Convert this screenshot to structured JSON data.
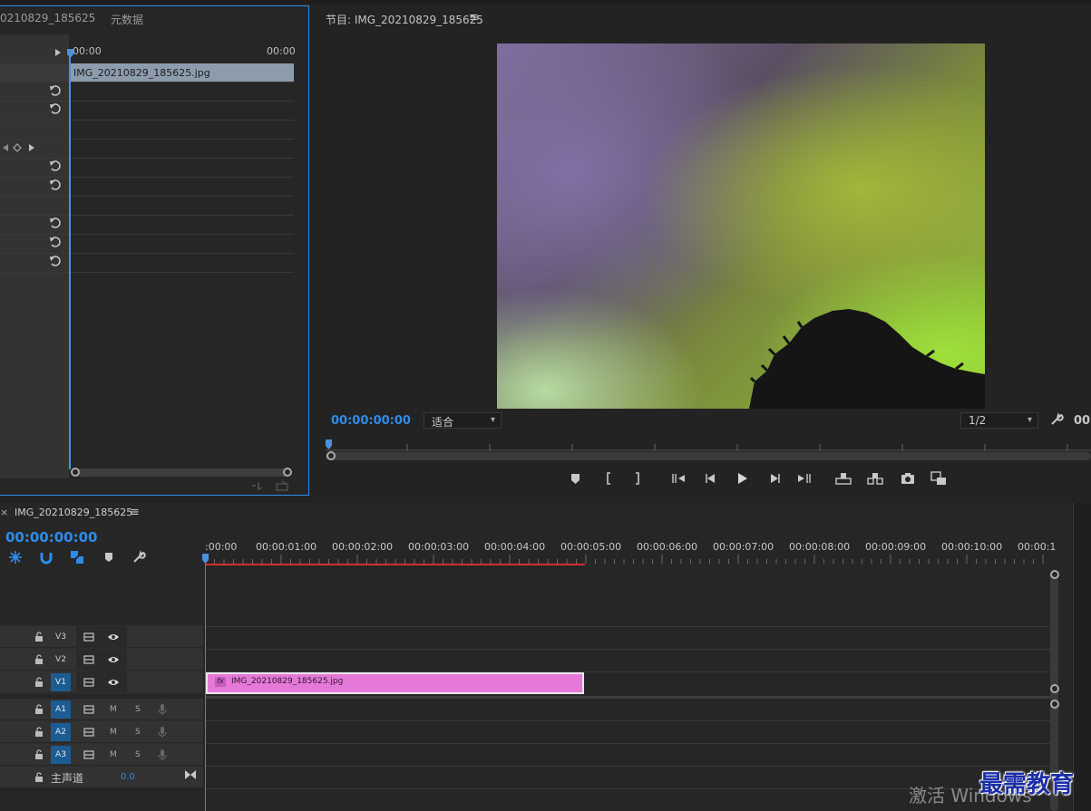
{
  "effect_controls": {
    "tab_source": "0210829_185625",
    "tab_metadata": "元数据",
    "start_tc": "00:00",
    "end_tc": "00:00",
    "clip_name": "IMG_20210829_185625.jpg"
  },
  "program_monitor": {
    "title": "节目: IMG_20210829_185625",
    "menu_icon": "≡",
    "timecode": "00:00:00:00",
    "fit_label": "适合",
    "resolution_label": "1/2",
    "end_timecode_partial": "00:"
  },
  "timeline": {
    "close_icon": "×",
    "sequence_name": "IMG_20210829_185625",
    "menu_icon": "≡",
    "timecode": "00:00:00:00",
    "ruler_labels": [
      ":00:00",
      "00:00:01:00",
      "00:00:02:00",
      "00:00:03:00",
      "00:00:04:00",
      "00:00:05:00",
      "00:00:06:00",
      "00:00:07:00",
      "00:00:08:00",
      "00:00:09:00",
      "00:00:10:00",
      "00:00:1"
    ],
    "video_tracks": [
      "V3",
      "V2",
      "V1"
    ],
    "audio_tracks": [
      "A1",
      "A2",
      "A3"
    ],
    "mute_label": "M",
    "solo_label": "S",
    "master_label": "主声道",
    "master_value": "0.0",
    "clip_name": "IMG_20210829_185625.jpg",
    "clip_fx": "fx"
  },
  "overlay": {
    "activate_windows": "激活 Windows",
    "logo_text": "最需教育"
  },
  "colors": {
    "accent_blue": "#2d8ceb",
    "clip_pink": "#e679d8",
    "red_bar": "#d22f2f",
    "panel_bg": "#262626"
  }
}
